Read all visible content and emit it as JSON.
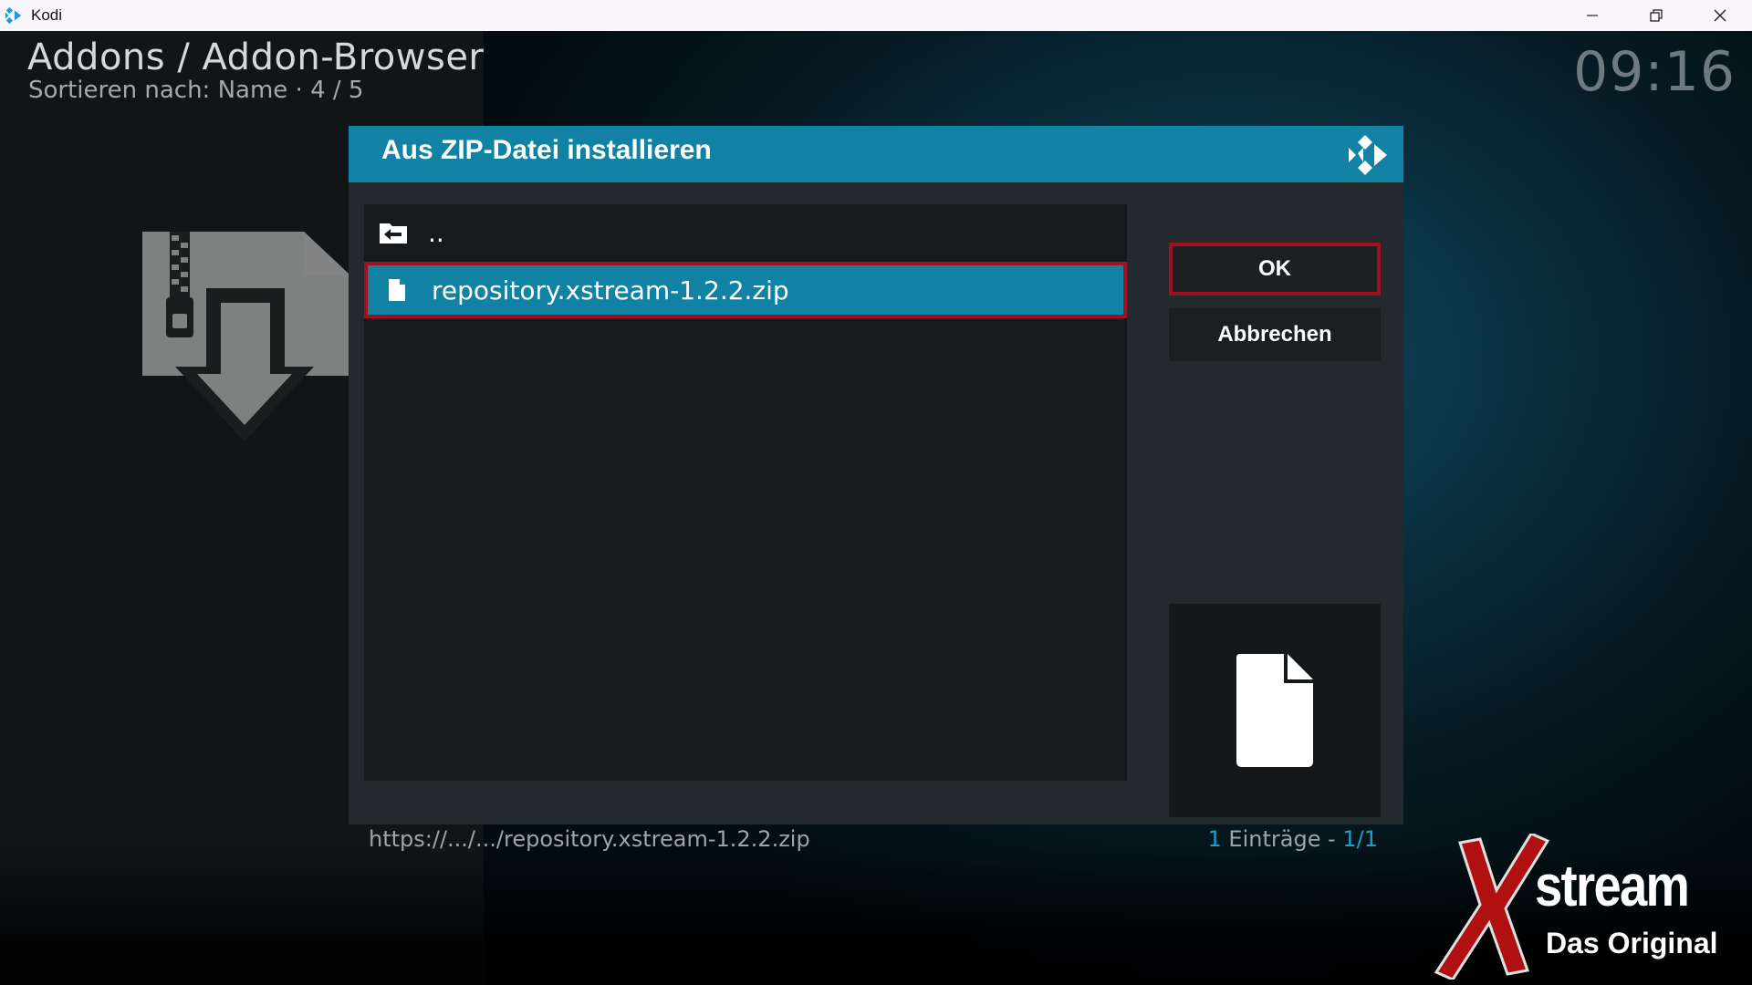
{
  "window": {
    "title": "Kodi",
    "controls": {
      "minimize": "—",
      "maximize": "❐",
      "close": "✕"
    }
  },
  "header": {
    "breadcrumb": "Addons / Addon-Browser",
    "sort_info": "Sortieren nach: Name  ·  4 / 5",
    "clock": "09:16"
  },
  "dialog": {
    "title": "Aus ZIP-Datei installieren",
    "list": [
      {
        "label": "..",
        "icon": "folder-back-icon",
        "selected": false
      },
      {
        "label": "repository.xstream-1.2.2.zip",
        "icon": "file-icon",
        "selected": true
      }
    ],
    "buttons": {
      "ok": "OK",
      "cancel": "Abbrechen"
    },
    "footer": {
      "path": "https://.../.../repository.xstream-1.2.2.zip",
      "count_num": "1",
      "count_label": " Einträge - ",
      "count_page": "1/1"
    }
  },
  "watermark": {
    "brand": "stream",
    "tagline": "Das Original"
  },
  "colors": {
    "accent": "#1282a4",
    "focus_border": "#a01020",
    "dialog_bg": "#232a2d",
    "highlight_text": "#1aa0cc"
  }
}
